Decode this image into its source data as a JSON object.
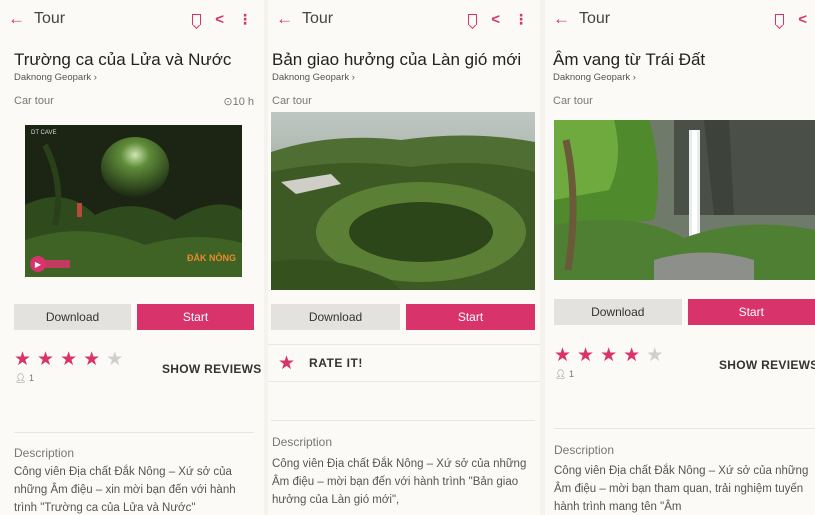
{
  "phones": [
    {
      "topbar": {
        "title": "Tour"
      },
      "tour_title": "Trường ca của Lửa và Nước",
      "provider": "Daknong Geopark ›",
      "category": "Car tour",
      "duration": "⊙10 h",
      "image_caption": "DT CAVE",
      "logo_text": "ĐẮK NÔNG",
      "download_label": "Download",
      "start_label": "Start",
      "rating": 4,
      "rating_max": 5,
      "review_count": "1",
      "show_reviews_label": "SHOW REVIEWS",
      "description_label": "Description",
      "description": "Công viên Địa chất Đắk Nông – Xứ sở của những Âm điệu – xin mời bạn đến với hành trình \"Trường ca của Lửa và Nước\""
    },
    {
      "topbar": {
        "title": "Tour"
      },
      "tour_title": "Bản giao hưởng của Làn gió mới",
      "provider": "Daknong Geopark ›",
      "category": "Car tour",
      "download_label": "Download",
      "start_label": "Start",
      "rate_label": "RATE IT!",
      "description_label": "Description",
      "description": "Công viên Địa chất Đắk Nông – Xứ sở của những Âm điệu – mời bạn đến với hành trình \"Bản giao hưởng của Làn gió mới\","
    },
    {
      "topbar": {
        "title": "Tour"
      },
      "tour_title": "Âm vang từ Trái Đất",
      "provider": "Daknong Geopark ›",
      "category": "Car tour",
      "download_label": "Download",
      "start_label": "Start",
      "rating": 4,
      "rating_max": 5,
      "review_count": "1",
      "show_reviews_label": "SHOW REVIEWS",
      "description_label": "Description",
      "description": "Công viên Địa chất Đắk Nông – Xứ sở của những Âm điệu – mời bạn tham quan, trải nghiệm tuyến hành trình mang tên \"Âm"
    }
  ],
  "colors": {
    "accent": "#d8336b",
    "button_gray": "#e4e2de",
    "background": "#fbfaf7"
  },
  "icons": [
    "back-arrow-icon",
    "bookmark-icon",
    "share-icon",
    "more-vert-icon",
    "star-icon",
    "user-icon",
    "clock-icon",
    "play-icon"
  ]
}
